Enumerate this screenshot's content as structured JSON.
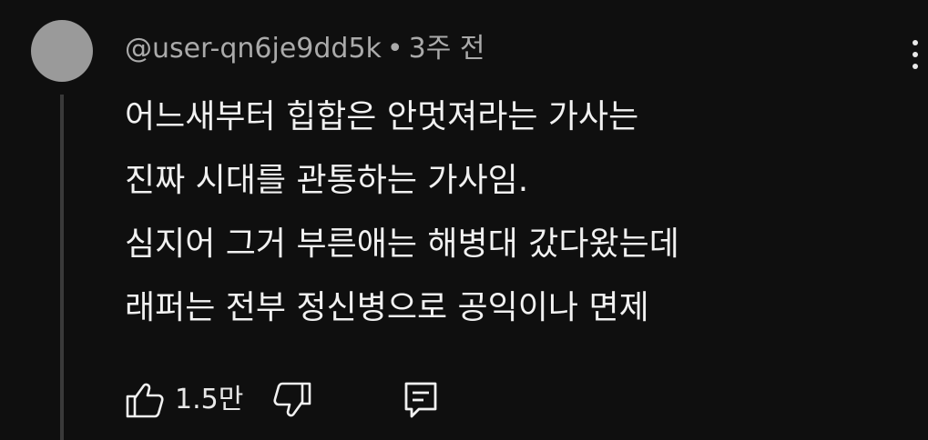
{
  "comment": {
    "author": "@user-qn6je9dd5k",
    "separator": "•",
    "time_ago": "3주 전",
    "lines": [
      "어느새부터 힙합은 안멋져라는 가사는",
      "진짜 시대를 관통하는 가사임.",
      "심지어 그거 부른애는 해병대 갔다왔는데",
      "래퍼는 전부 정신병으로 공익이나 면제"
    ],
    "like_count": "1.5만"
  },
  "icons": {
    "avatar": "avatar",
    "more": "more-vertical-icon",
    "like": "thumb-up-icon",
    "dislike": "thumb-down-icon",
    "reply": "reply-comment-icon"
  },
  "colors": {
    "background": "#0f0f0f",
    "text_primary": "#f1f1f1",
    "text_secondary": "#aaaaaa",
    "avatar": "#9a9a9a"
  }
}
